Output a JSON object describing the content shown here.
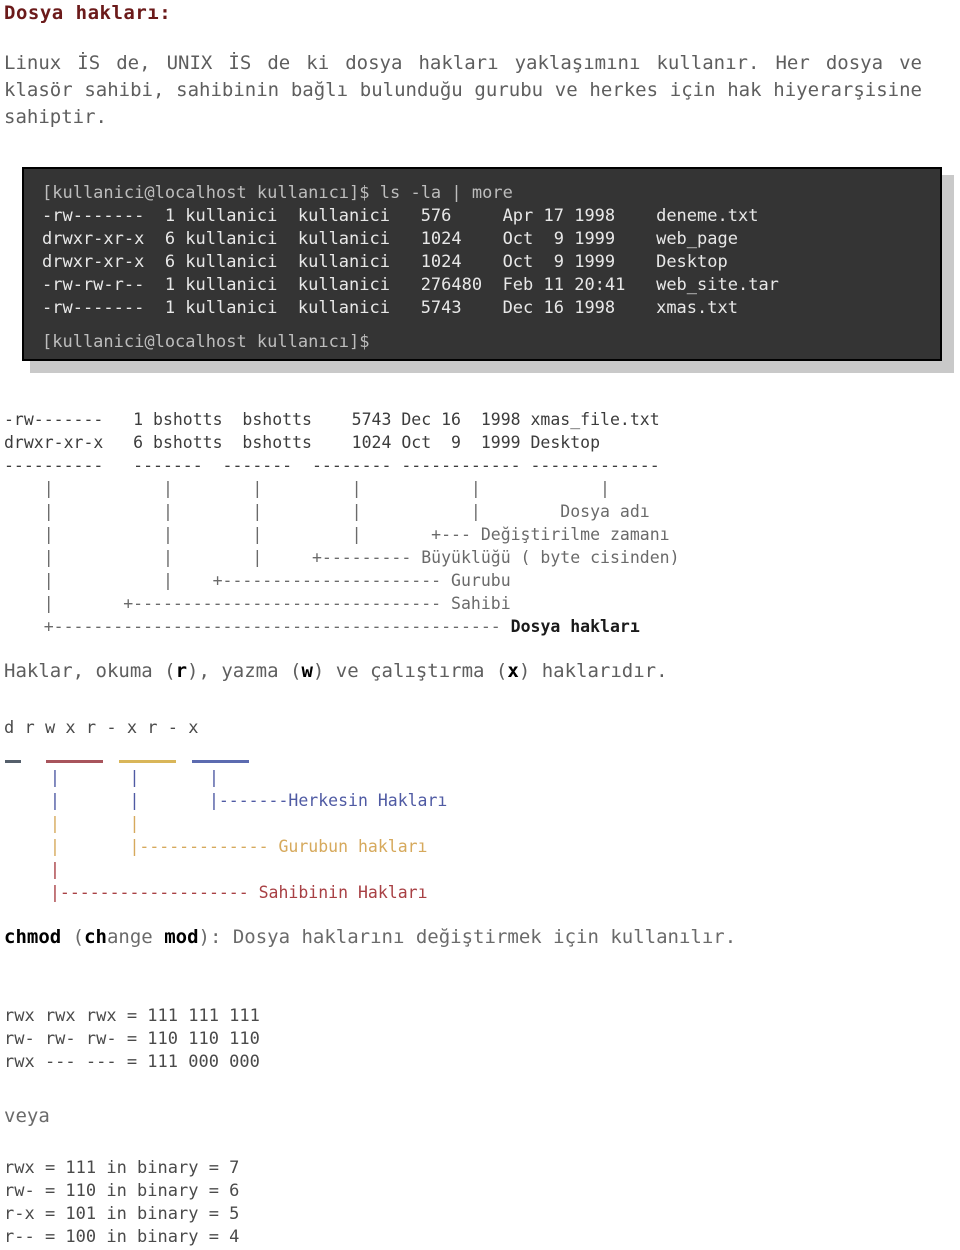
{
  "title": "Dosya hakları:",
  "intro": "Linux İS de,  UNIX İS de ki dosya hakları yaklaşımını kullanır.  Her dosya ve klasör sahibi, sahibinin bağlı bulunduğu gurubu ve herkes için hak hiyerarşisine sahiptir.",
  "terminal": {
    "prompt_top": "[kullanici@localhost kullanıcı]$ ls -la | more",
    "prompt_bottom": "[kullanici@localhost kullanıcı]$",
    "rows": [
      "-rw-------  1 kullanici  kullanici   576     Apr 17 1998    deneme.txt",
      "drwxr-xr-x  6 kullanici  kullanici   1024    Oct  9 1999    web_page",
      "drwxr-xr-x  6 kullanici  kullanici   1024    Oct  9 1999    Desktop",
      "-rw-rw-r--  1 kullanici  kullanici   276480  Feb 11 20:41   web_site.tar",
      "-rw-------  1 kullanici  kullanici   5743    Dec 16 1998    xmas.txt"
    ],
    "colors": {
      "background": "#343434",
      "text": "#e8e8e8",
      "border": "#000000",
      "shadow": "#c9c9c9"
    }
  },
  "anatomy": {
    "sample_rows": [
      "-rw-------   1 bshotts  bshotts    5743 Dec 16  1998 xmas_file.txt",
      "drwxr-xr-x   6 bshotts  bshotts    1024 Oct  9  1999 Desktop"
    ],
    "rule_line": "----------   -------  -------  -------- ------------ -------------",
    "tree_lines": [
      "    |           |        |         |           |            |",
      "    |           |        |         |           |        Dosya adı",
      "    |           |        |         |       +--- Değiştirilme zamanı",
      "    |           |        |     +--------- Büyüklüğü ( byte cisinden)",
      "    |           |    +---------------------- Gurubu",
      "    |       +------------------------------- Sahibi",
      "    +--------------------------------------------- "
    ],
    "last_label": "Dosya hakları",
    "labels": [
      "Dosya adı",
      "Değiştirilme zamanı",
      "Büyüklüğü ( byte cisinden)",
      "Gurubu",
      "Sahibi",
      "Dosya hakları"
    ]
  },
  "haklar_sentence": {
    "part1": "Haklar, okuma (",
    "r": "r",
    "part2": "), yazma (",
    "w": "w",
    "part3": ") ve çalıştırma (",
    "x": "x",
    "part4": ") haklarıdır."
  },
  "perm_diagram": {
    "letters": "d r w x r - x r - x",
    "dash": "-",
    "other_line": "|       |       |-------",
    "other_label": "Herkesin Hakları",
    "other_mid": "|       |",
    "group_line": "|       |------------- ",
    "group_label": "Gurubun hakları",
    "owner_mid": "|",
    "owner_line": "|------------------- ",
    "owner_label": "Sahibinin Hakları",
    "colors": {
      "owner": "#a84044",
      "group": "#d6a95c",
      "other": "#4f5aa3",
      "type": "#555f6b"
    }
  },
  "chmod": {
    "cmd": "chmod",
    "paren_open": " (",
    "ch": "ch",
    "ange": "ange ",
    "mod": "mod",
    "paren_close": "): ",
    "desc": "Dosya haklarını değiştirmek için kullanılır."
  },
  "octal_table": [
    "rwx rwx rwx = 111 111 111",
    "rw- rw- rw- = 110 110 110",
    "rwx --- --- = 111 000 000"
  ],
  "veya": "veya",
  "binary_table": [
    "rwx = 111 in binary = 7",
    "rw- = 110 in binary = 6",
    "r-x = 101 in binary = 5",
    "r-- = 100 in binary = 4"
  ]
}
